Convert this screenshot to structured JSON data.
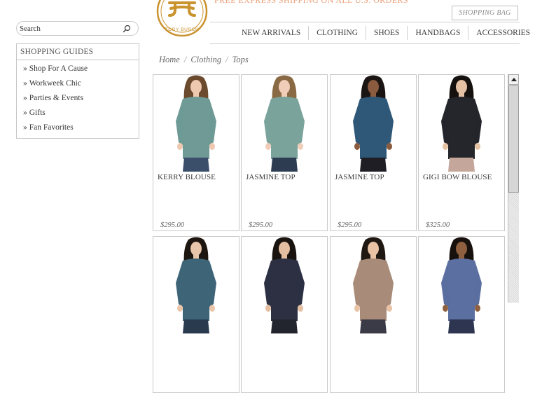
{
  "header": {
    "brand": "TORY BURCH",
    "promo": "FREE EXPRESS SHIPPING ON ALL U.S. ORDERS",
    "shopping_bag": "SHOPPING BAG",
    "brand_color": "#c9932e"
  },
  "nav": [
    {
      "label": "NEW ARRIVALS"
    },
    {
      "label": "CLOTHING"
    },
    {
      "label": "SHOES"
    },
    {
      "label": "HANDBAGS"
    },
    {
      "label": "ACCESSORIES"
    }
  ],
  "search": {
    "placeholder": "Search",
    "icon": "search-icon"
  },
  "sidebar": {
    "title": "SHOPPING GUIDES",
    "items": [
      {
        "label": "Shop For A Cause"
      },
      {
        "label": "Workweek Chic"
      },
      {
        "label": "Parties & Events"
      },
      {
        "label": "Gifts"
      },
      {
        "label": "Fan Favorites"
      }
    ]
  },
  "breadcrumb": [
    "Home",
    "Clothing",
    "Tops"
  ],
  "products": [
    {
      "name": "KERRY BLOUSE",
      "price": "$295.00",
      "top_color": "#6f9a96",
      "bottom_color": "#3b4f6b",
      "hair": "#6b4a2e",
      "skin": "#efc8b0"
    },
    {
      "name": "JASMINE TOP",
      "price": "$295.00",
      "top_color": "#7aa39c",
      "bottom_color": "#2e3c52",
      "hair": "#8a6a44",
      "skin": "#efcdb8"
    },
    {
      "name": "JASMINE TOP",
      "price": "$295.00",
      "top_color": "#2f5878",
      "bottom_color": "#1e1e24",
      "hair": "#1a1412",
      "skin": "#8a5b3e"
    },
    {
      "name": "GIGI BOW BLOUSE",
      "price": "$325.00",
      "top_color": "#24262b",
      "bottom_color": "#c4a79a",
      "hair": "#15110f",
      "skin": "#e6c2a4"
    },
    {
      "name": "",
      "price": "",
      "top_color": "#3e6478",
      "bottom_color": "#2a3a4e",
      "hair": "#1d1510",
      "skin": "#e9c6aa"
    },
    {
      "name": "",
      "price": "",
      "top_color": "#2c3042",
      "bottom_color": "#22242e",
      "hair": "#1a1411",
      "skin": "#e4bea0"
    },
    {
      "name": "",
      "price": "",
      "top_color": "#a88b78",
      "bottom_color": "#3b3b48",
      "hair": "#1e1712",
      "skin": "#e8c3a6"
    },
    {
      "name": "",
      "price": "",
      "top_color": "#5b6fa0",
      "bottom_color": "#2d3550",
      "hair": "#17110e",
      "skin": "#8e603f"
    }
  ]
}
